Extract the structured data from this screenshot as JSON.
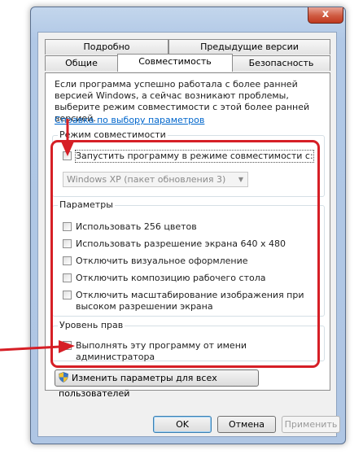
{
  "window": {
    "close_label": "x"
  },
  "tabs_top": [
    {
      "label": "Подробно"
    },
    {
      "label": "Предыдущие версии"
    }
  ],
  "tabs_bottom": [
    {
      "label": "Общие"
    },
    {
      "label": "Совместимость"
    },
    {
      "label": "Безопасность"
    }
  ],
  "description": "Если программа успешно работала с более ранней версией Windows, а сейчас возникают проблемы, выберите режим совместимости с этой более ранней версией.",
  "help_link": "Справка по выбору параметров",
  "compat_mode": {
    "title": "Режим совместимости",
    "checkbox_label": "Запустить программу в режиме совместимости с:",
    "select_value": "Windows XP (пакет обновления 3)"
  },
  "parameters": {
    "title": "Параметры",
    "items": [
      "Использовать 256 цветов",
      "Использовать разрешение экрана 640 x 480",
      "Отключить визуальное оформление",
      "Отключить композицию рабочего стола",
      "Отключить масштабирование изображения при высоком разрешении экрана"
    ]
  },
  "privilege": {
    "title": "Уровень прав",
    "checkbox_label": "Выполнять эту программу от имени администратора"
  },
  "change_all_button": "Изменить параметры для всех пользователей",
  "buttons": {
    "ok": "OK",
    "cancel": "Отмена",
    "apply": "Применить"
  },
  "colors": {
    "annotation_red": "#d61f26",
    "link": "#0066cc"
  }
}
